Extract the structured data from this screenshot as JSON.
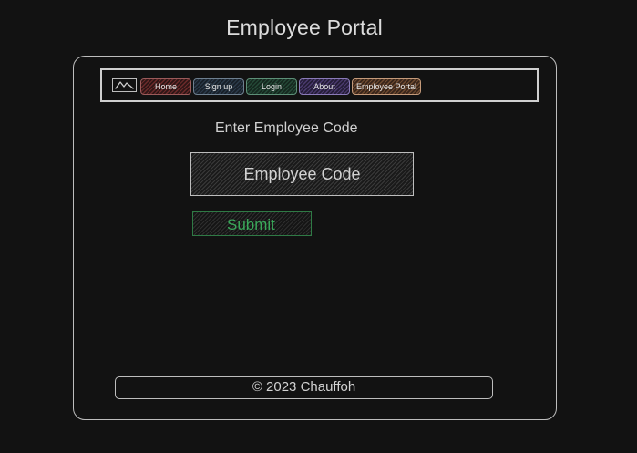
{
  "page": {
    "title": "Employee Portal"
  },
  "nav": {
    "logo_icon": "mountain-logo-icon",
    "items": [
      {
        "label": "Home",
        "color": "#6b2a2a"
      },
      {
        "label": "Sign up",
        "color": "#2b3a4a"
      },
      {
        "label": "Login",
        "color": "#254a38"
      },
      {
        "label": "About",
        "color": "#4a3a6e"
      },
      {
        "label": "Employee Portal",
        "color": "#6e4a30"
      }
    ]
  },
  "form": {
    "prompt": "Enter Employee Code",
    "code_placeholder": "Employee Code",
    "code_value": "",
    "submit_label": "Submit",
    "submit_color": "#3aa85a"
  },
  "footer": {
    "text": "© 2023 Chauffoh"
  },
  "theme": {
    "background": "#121212",
    "border": "#bdbdbd"
  }
}
